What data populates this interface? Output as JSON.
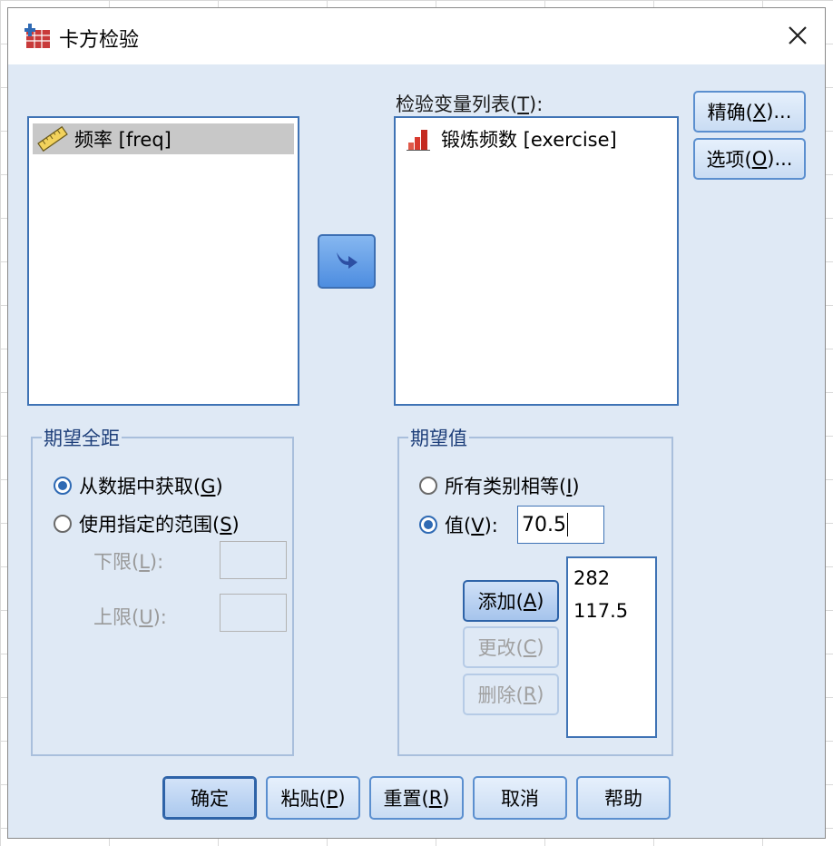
{
  "window": {
    "title": "卡方检验",
    "app_icon": "spss-table-icon",
    "close_icon": "close-icon"
  },
  "source_list": {
    "items": [
      {
        "label": "频率 [freq]",
        "icon": "ruler-scale-icon",
        "selected": true
      }
    ]
  },
  "move_button": {
    "icon": "arrow-right-icon"
  },
  "test_list": {
    "label_prefix": "检验变量列表(",
    "label_mn": "T",
    "label_suffix": "):",
    "items": [
      {
        "label": "锻炼频数 [exercise]",
        "icon": "ordinal-bar-icon"
      }
    ]
  },
  "side_buttons": {
    "exact": {
      "prefix": "精确(",
      "mn": "X",
      "suffix": ")..."
    },
    "options": {
      "prefix": "选项(",
      "mn": "O",
      "suffix": ")..."
    }
  },
  "expected_range": {
    "title": "期望全距",
    "from_data": {
      "prefix": "从数据中获取(",
      "mn": "G",
      "suffix": ")",
      "checked": true
    },
    "use_specified": {
      "prefix": "使用指定的范围(",
      "mn": "S",
      "suffix": ")",
      "checked": false
    },
    "lower": {
      "prefix": "下限(",
      "mn": "L",
      "suffix": "):",
      "value": ""
    },
    "upper": {
      "prefix": "上限(",
      "mn": "U",
      "suffix": "):",
      "value": ""
    }
  },
  "expected_values": {
    "title": "期望值",
    "all_equal": {
      "prefix": "所有类别相等(",
      "mn": "I",
      "suffix": ")",
      "checked": false
    },
    "values": {
      "prefix": "值(",
      "mn": "V",
      "suffix": "):",
      "checked": true
    },
    "value_input": "70.5",
    "add": {
      "prefix": "添加(",
      "mn": "A",
      "suffix": ")"
    },
    "change": {
      "prefix": "更改(",
      "mn": "C",
      "suffix": ")"
    },
    "remove": {
      "prefix": "删除(",
      "mn": "R",
      "suffix": ")"
    },
    "value_list": [
      "282",
      "117.5"
    ]
  },
  "footer": {
    "ok": "确定",
    "paste": {
      "prefix": "粘贴(",
      "mn": "P",
      "suffix": ")"
    },
    "reset": {
      "prefix": "重置(",
      "mn": "R",
      "suffix": ")"
    },
    "cancel": "取消",
    "help": "帮助"
  },
  "colors": {
    "dialog_bg": "#dfe9f5",
    "accent": "#3f73b5",
    "group_title": "#1e3f7a"
  }
}
